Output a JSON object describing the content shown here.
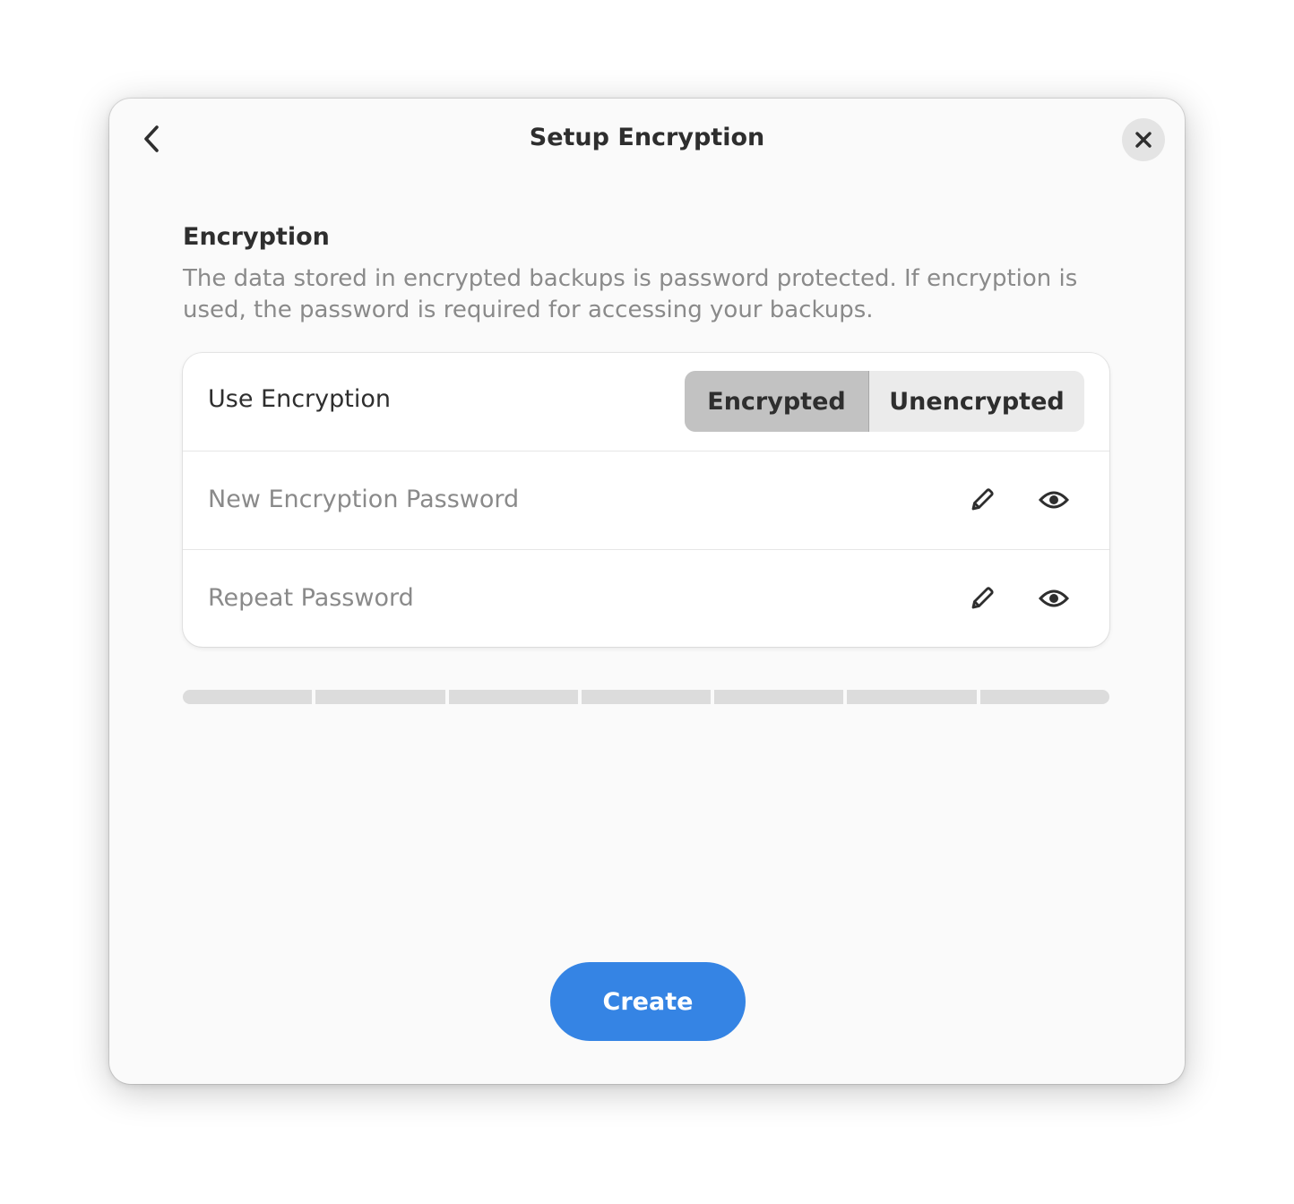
{
  "window": {
    "title": "Setup Encryption",
    "back_icon": "go-previous-icon",
    "close_icon": "window-close-icon"
  },
  "encryption": {
    "section_title": "Encryption",
    "description": "The data stored in encrypted backups is password protected. If encryption is used, the password is required for accessing your backups.",
    "use_encryption_label": "Use Encryption",
    "options": [
      "Encrypted",
      "Unencrypted"
    ],
    "selected": "Encrypted",
    "new_password": {
      "value": "",
      "placeholder": "New Encryption Password",
      "edit_icon": "pencil-icon",
      "reveal_icon": "eye-icon"
    },
    "repeat_password": {
      "value": "",
      "placeholder": "Repeat Password",
      "edit_icon": "pencil-icon",
      "reveal_icon": "eye-icon"
    },
    "strength_level": 0,
    "strength_segments": 7
  },
  "actions": {
    "create_label": "Create"
  },
  "colors": {
    "accent": "#3584e4",
    "window_bg": "#fafafa",
    "card_bg": "#ffffff",
    "toggle_active": "#c2c2c2",
    "toggle_inactive": "#ebebeb",
    "strength_empty": "#dcdcdc"
  }
}
